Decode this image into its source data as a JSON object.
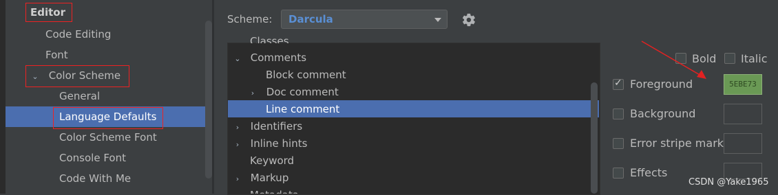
{
  "settings_tree": {
    "editor": "Editor",
    "code_editing": "Code Editing",
    "font": "Font",
    "color_scheme": "Color Scheme",
    "general": "General",
    "language_defaults": "Language Defaults",
    "color_scheme_font": "Color Scheme Font",
    "console_font": "Console Font",
    "code_with_me": "Code With Me"
  },
  "scheme": {
    "label": "Scheme:",
    "value": "Darcula"
  },
  "element_tree": {
    "classes": "Classes",
    "comments": "Comments",
    "block_comment": "Block comment",
    "doc_comment": "Doc comment",
    "line_comment": "Line comment",
    "identifiers": "Identifiers",
    "inline_hints": "Inline hints",
    "keyword": "Keyword",
    "markup": "Markup",
    "metadata": "Metadata"
  },
  "attributes": {
    "bold": "Bold",
    "italic": "Italic",
    "foreground": "Foreground",
    "foreground_value": "5EBE73",
    "background": "Background",
    "error_stripe_mark": "Error stripe mark",
    "effects": "Effects"
  },
  "watermark": "CSDN @Yake1965",
  "colors": {
    "selection": "#4b6eaf",
    "annotation": "#e22222",
    "foreground_swatch": "#6a9955"
  },
  "icons": {
    "settings": "gear-icon",
    "collapse": "chevron-down-icon",
    "expand": "chevron-right-icon"
  }
}
